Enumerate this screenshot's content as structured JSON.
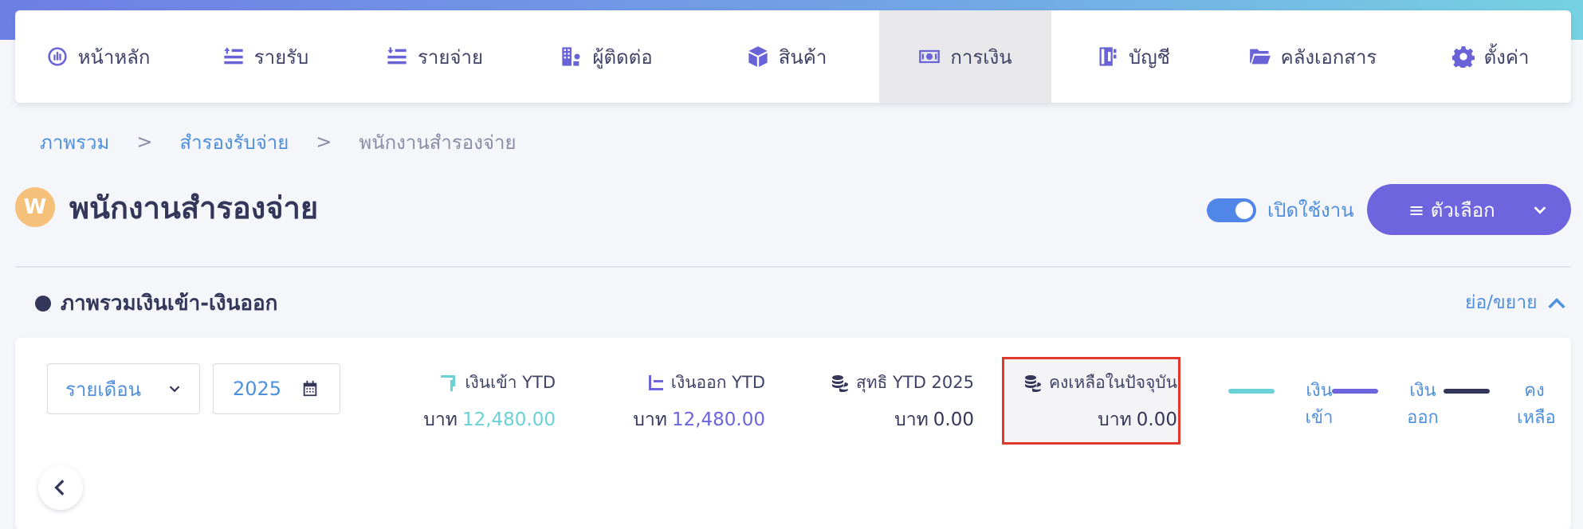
{
  "nav": {
    "items": [
      {
        "label": "หน้าหลัก",
        "icon": "dashboard-icon",
        "active": false
      },
      {
        "label": "รายรับ",
        "icon": "income-icon",
        "active": false
      },
      {
        "label": "รายจ่าย",
        "icon": "expense-icon",
        "active": false
      },
      {
        "label": "ผู้ติดต่อ",
        "icon": "contacts-icon",
        "active": false
      },
      {
        "label": "สินค้า",
        "icon": "box-icon",
        "active": false
      },
      {
        "label": "การเงิน",
        "icon": "money-icon",
        "active": true
      },
      {
        "label": "บัญชี",
        "icon": "accounting-icon",
        "active": false
      },
      {
        "label": "คลังเอกสาร",
        "icon": "folder-icon",
        "active": false
      },
      {
        "label": "ตั้งค่า",
        "icon": "gear-icon",
        "active": false
      }
    ]
  },
  "breadcrumb": {
    "items": [
      "ภาพรวม",
      "สำรองรับจ่าย",
      "พนักงานสำรองจ่าย"
    ],
    "separator": ">"
  },
  "page": {
    "avatar_letter": "W",
    "title": "พนักงานสำรองจ่าย",
    "toggle_label": "เปิดใช้งาน",
    "toggle_on": true,
    "options_label": "≡ ตัวเลือก"
  },
  "section": {
    "title": "ภาพรวมเงินเข้า-เงินออก",
    "collapse_label": "ย่อ/ขยาย"
  },
  "filters": {
    "period": "รายเดือน",
    "year": "2025"
  },
  "stats": {
    "in": {
      "label": "เงินเข้า YTD",
      "currency": "บาท",
      "value": "12,480.00"
    },
    "out": {
      "label": "เงินออก YTD",
      "currency": "บาท",
      "value": "12,480.00"
    },
    "net": {
      "label": "สุทธิ YTD 2025",
      "currency": "บาท",
      "value": "0.00"
    },
    "balance": {
      "label": "คงเหลือในปัจจุบัน",
      "currency": "บาท",
      "value": "0.00"
    }
  },
  "legend": [
    {
      "line1": "เงิน",
      "line2": "เข้า",
      "color": "#6ad1d6"
    },
    {
      "line1": "เงิน",
      "line2": "ออก",
      "color": "#6e64de"
    },
    {
      "line1": "คง",
      "line2": "เหลือ",
      "color": "#34365a"
    }
  ],
  "colors": {
    "accent": "#6e64de",
    "link": "#4e8fde",
    "highlight_border": "#e0392b"
  }
}
